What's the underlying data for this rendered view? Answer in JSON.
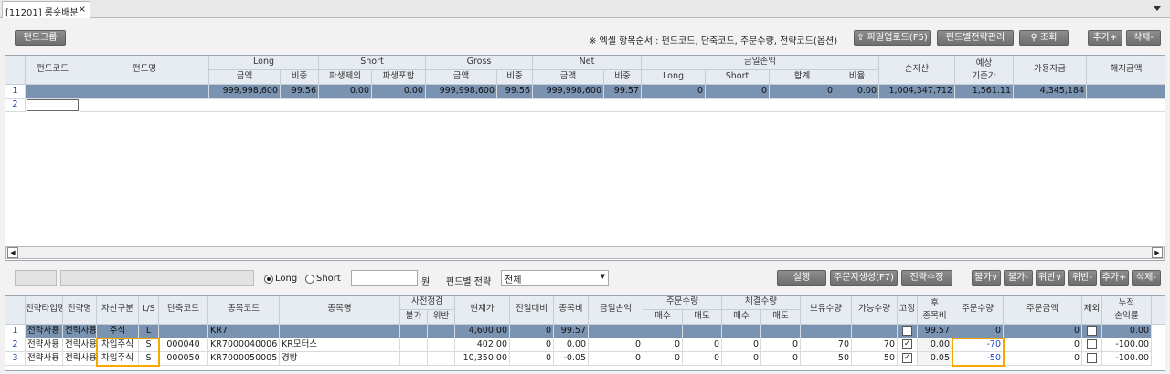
{
  "tab": {
    "title": "[11201] 롱숏배분",
    "close": "×"
  },
  "toolbar": {
    "fund_group": "펀드그룹",
    "note": "※ 엑셀 항목순서 : 펀드코드, 단축코드, 주문수량, 전략코드(옵션)",
    "upload": "파일업로드(F5)",
    "strategy_mgmt": "펀드별전략관리",
    "search": "조회",
    "add": "추가+",
    "delete": "삭제-"
  },
  "fund_grid": {
    "headers": {
      "rownum": "",
      "code": "펀드코드",
      "name": "펀드명",
      "long": "Long",
      "long_amt": "금액",
      "long_ratio": "비중",
      "short": "Short",
      "short_excl": "파생제외",
      "short_incl": "파생포함",
      "gross": "Gross",
      "gross_amt": "금액",
      "gross_ratio": "비중",
      "net": "Net",
      "net_amt": "금액",
      "net_ratio": "비중",
      "pnl": "금일손익",
      "pnl_long": "Long",
      "pnl_short": "Short",
      "pnl_sum": "합계",
      "pnl_rate": "비율",
      "nav": "순자산",
      "exp_base_1": "예상",
      "exp_base_2": "기준가",
      "avail": "가용자금",
      "cancel": "해지금액"
    },
    "rows": [
      {
        "no": "1",
        "code": "",
        "name": "",
        "long_amt": "999,998,600",
        "long_ratio": "99.56",
        "short_excl": "0.00",
        "short_incl": "0.00",
        "gross_amt": "999,998,600",
        "gross_ratio": "99.56",
        "net_amt": "999,998,600",
        "net_ratio": "99.57",
        "pnl_long": "0",
        "pnl_short": "0",
        "pnl_sum": "0",
        "pnl_rate": "0.00",
        "nav": "1,004,347,712",
        "exp_base": "1,561.11",
        "avail": "4,345,184",
        "cancel": ""
      },
      {
        "no": "2"
      }
    ]
  },
  "order_bar": {
    "long": "Long",
    "short": "Short",
    "won": "원",
    "strategy_label": "펀드별 전략",
    "strategy_value": "전체",
    "run": "실행",
    "gen_order": "주문지생성(F7)",
    "edit_strategy": "전략수정",
    "buy_plus": "불가∨",
    "buy_minus": "불가-",
    "viol_plus": "위반∨",
    "viol_minus": "위반-",
    "add": "추가+",
    "delete": "삭제-"
  },
  "stock_grid": {
    "headers": {
      "stype": "전략타입명",
      "sname": "전략명",
      "asset": "자산구분",
      "ls": "L/S",
      "short_code": "단축코드",
      "item_code": "종목코드",
      "item_name": "종목명",
      "precheck": "사전점검",
      "pc_block": "불가",
      "pc_viol": "위반",
      "price": "현재가",
      "change": "전일대비",
      "weight": "종목비",
      "pnl": "금일손익",
      "order_qty_grp": "주문수량",
      "o_buy": "매수",
      "o_sell": "매도",
      "fill_qty_grp": "체결수량",
      "f_buy": "매수",
      "f_sell": "매도",
      "hold": "보유수량",
      "avail": "가능수량",
      "fix": "고정",
      "post_1": "후",
      "post_2": "종목비",
      "order_qty": "주문수량",
      "order_amt": "주문금액",
      "excl": "제외",
      "cum_1": "누적",
      "cum_2": "손익률"
    },
    "rows": [
      {
        "no": "1",
        "stype": "전략사용",
        "sname": "전략사용",
        "asset": "주식",
        "ls": "L",
        "short_code": "",
        "item_code": "KR7",
        "item_name": "",
        "price": "4,600.00",
        "change": "0",
        "weight": "99.57",
        "pnl": "",
        "o_buy": "",
        "o_sell": "",
        "f_buy": "",
        "f_sell": "",
        "hold": "",
        "avail": "",
        "fix": "",
        "post": "99.57",
        "order_qty": "0",
        "order_amt": "0",
        "cum": "0.00"
      },
      {
        "no": "2",
        "stype": "전략사용",
        "sname": "전략사용",
        "asset": "차입주식",
        "ls": "S",
        "short_code": "000040",
        "item_code": "KR7000040006",
        "item_name": "KR모터스",
        "price": "402.00",
        "change": "0",
        "weight": "0.00",
        "pnl": "0",
        "o_buy": "0",
        "o_sell": "0",
        "f_buy": "0",
        "f_sell": "0",
        "hold": "70",
        "avail": "70",
        "fix": "✓",
        "post": "0.00",
        "order_qty": "-70",
        "order_amt": "0",
        "cum": "-100.00"
      },
      {
        "no": "3",
        "stype": "전략사용",
        "sname": "전략사용",
        "asset": "차입주식",
        "ls": "S",
        "short_code": "000050",
        "item_code": "KR7000050005",
        "item_name": "경방",
        "price": "10,350.00",
        "change": "0",
        "weight": "-0.05",
        "pnl": "0",
        "o_buy": "0",
        "o_sell": "0",
        "f_buy": "0",
        "f_sell": "0",
        "hold": "50",
        "avail": "50",
        "fix": "✓",
        "post": "0.05",
        "order_qty": "-50",
        "order_amt": "0",
        "cum": "-100.00"
      }
    ]
  }
}
